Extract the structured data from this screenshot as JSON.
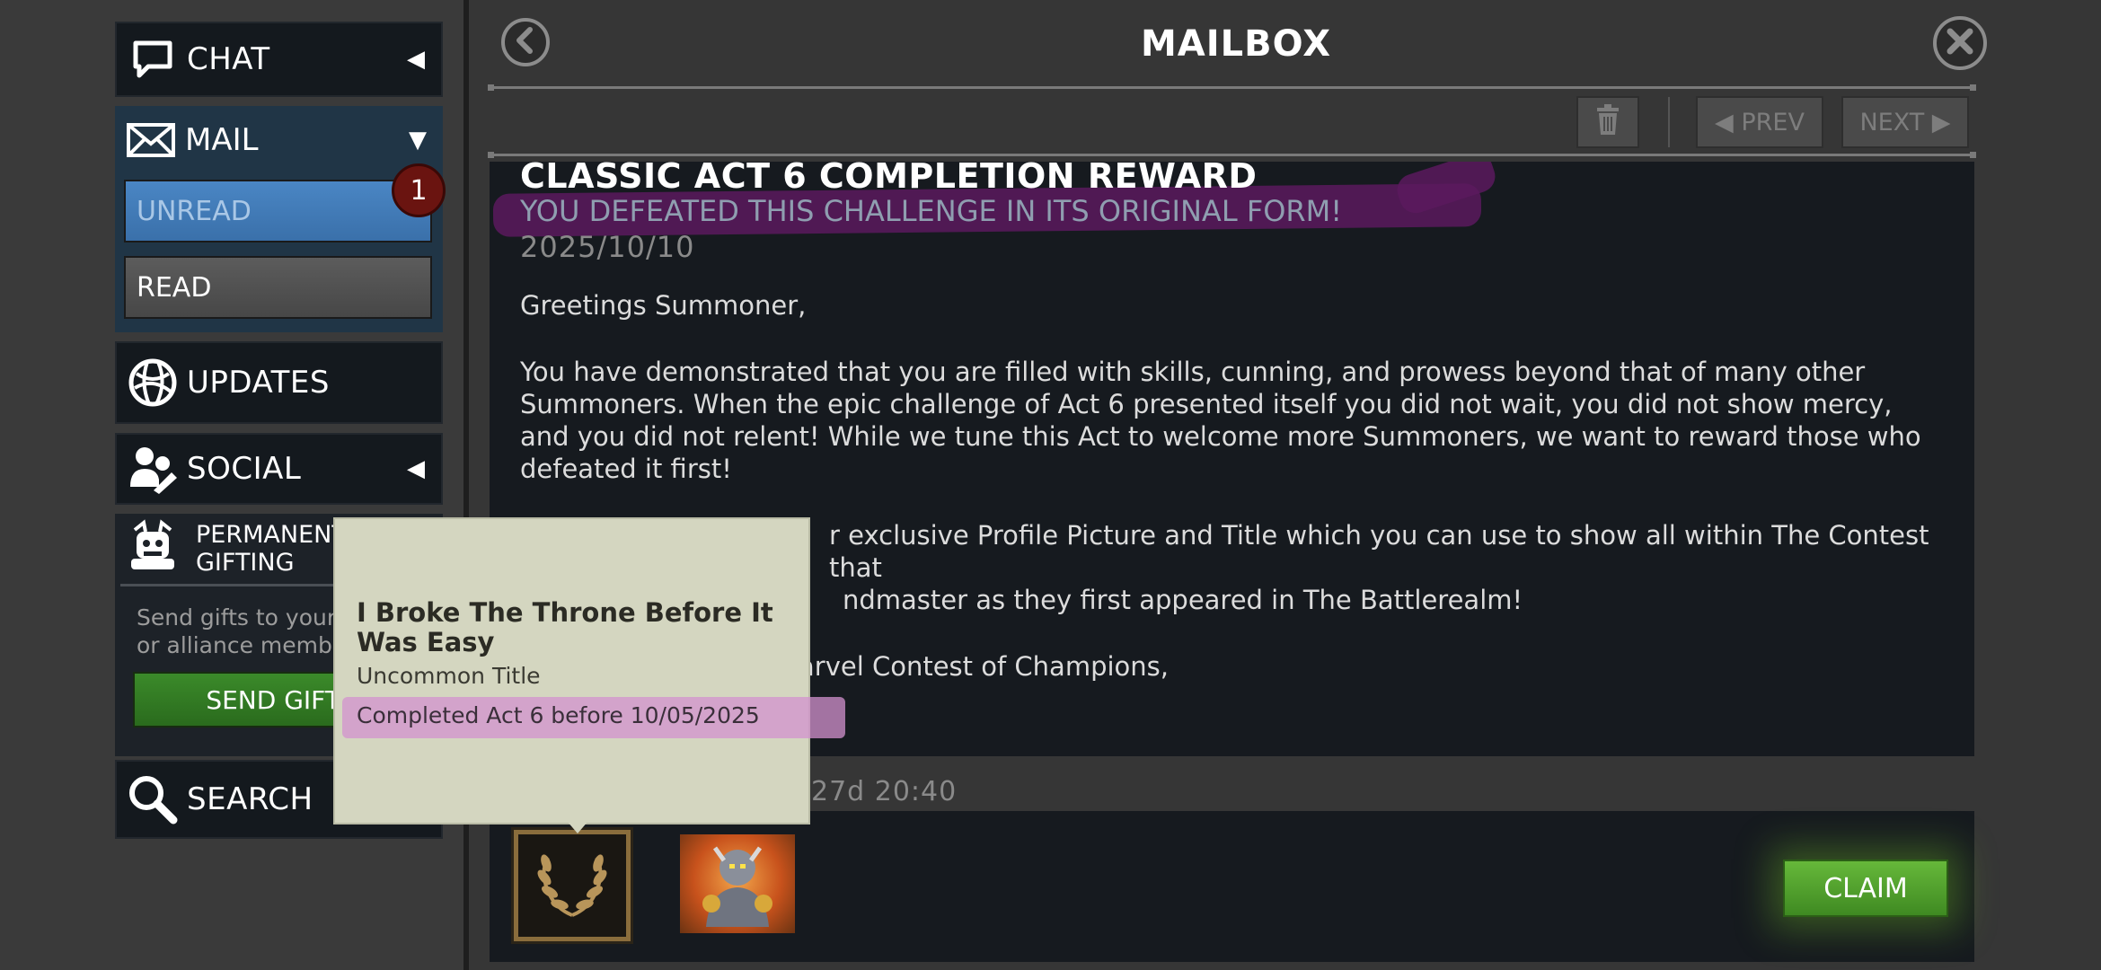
{
  "sidebar": {
    "chat": {
      "label": "CHAT",
      "arrow": "◀"
    },
    "mail": {
      "label": "MAIL",
      "arrow": "▼",
      "unread_label": "UNREAD",
      "read_label": "READ",
      "badge": "1"
    },
    "updates": {
      "label": "UPDATES"
    },
    "social": {
      "label": "SOCIAL",
      "arrow": "◀"
    },
    "gifting": {
      "title_line1": "PERMANENT",
      "title_line2": "GIFTING",
      "desc_line1": "Send gifts to your friends",
      "desc_line2": "or alliance members",
      "button_label": "SEND GIFTS"
    },
    "search": {
      "label": "SEARCH"
    }
  },
  "header": {
    "title": "MAILBOX",
    "back_icon": "chevron-left-icon",
    "close_icon": "close-icon"
  },
  "toolbar": {
    "delete_icon": "trash-icon",
    "prev_label": "◀ PREV",
    "next_label": "NEXT ▶"
  },
  "message": {
    "title": "CLASSIC ACT 6 COMPLETION REWARD",
    "subtitle": "YOU DEFEATED THIS CHALLENGE IN ITS ORIGINAL FORM!",
    "date": "2025/10/10",
    "greeting": "Greetings Summoner,",
    "paragraph1": "You have demonstrated that you are filled with skills, cunning, and prowess beyond that of many other Summoners. When the epic challenge of Act 6 presented itself you did not wait, you did not show mercy, and you did not relent! While we tune this Act to welcome more Summoners, we want to reward those who defeated it first!",
    "paragraph2": "r exclusive Profile Picture and Title which you can use to show all within The Contest that",
    "paragraph2b": "ndmaster as they first appeared in The Battlerealm!",
    "signoff": "arvel Contest of Champions,",
    "expiry": "27d 20:40"
  },
  "rewards": {
    "items": [
      {
        "type": "title",
        "icon": "laurel-wreath-icon"
      },
      {
        "type": "profile-picture",
        "icon": "champion-portrait-icon"
      }
    ],
    "claim_label": "CLAIM"
  },
  "tooltip": {
    "name": "I Broke The Throne Before It Was Easy",
    "rarity": "Uncommon Title",
    "description": "Completed Act 6 before 10/05/2025"
  },
  "colors": {
    "highlight": "#5a1a5e",
    "claim_green": "#4e9e2c",
    "unread_blue": "#3f78b6",
    "badge_red": "#6a1410"
  }
}
